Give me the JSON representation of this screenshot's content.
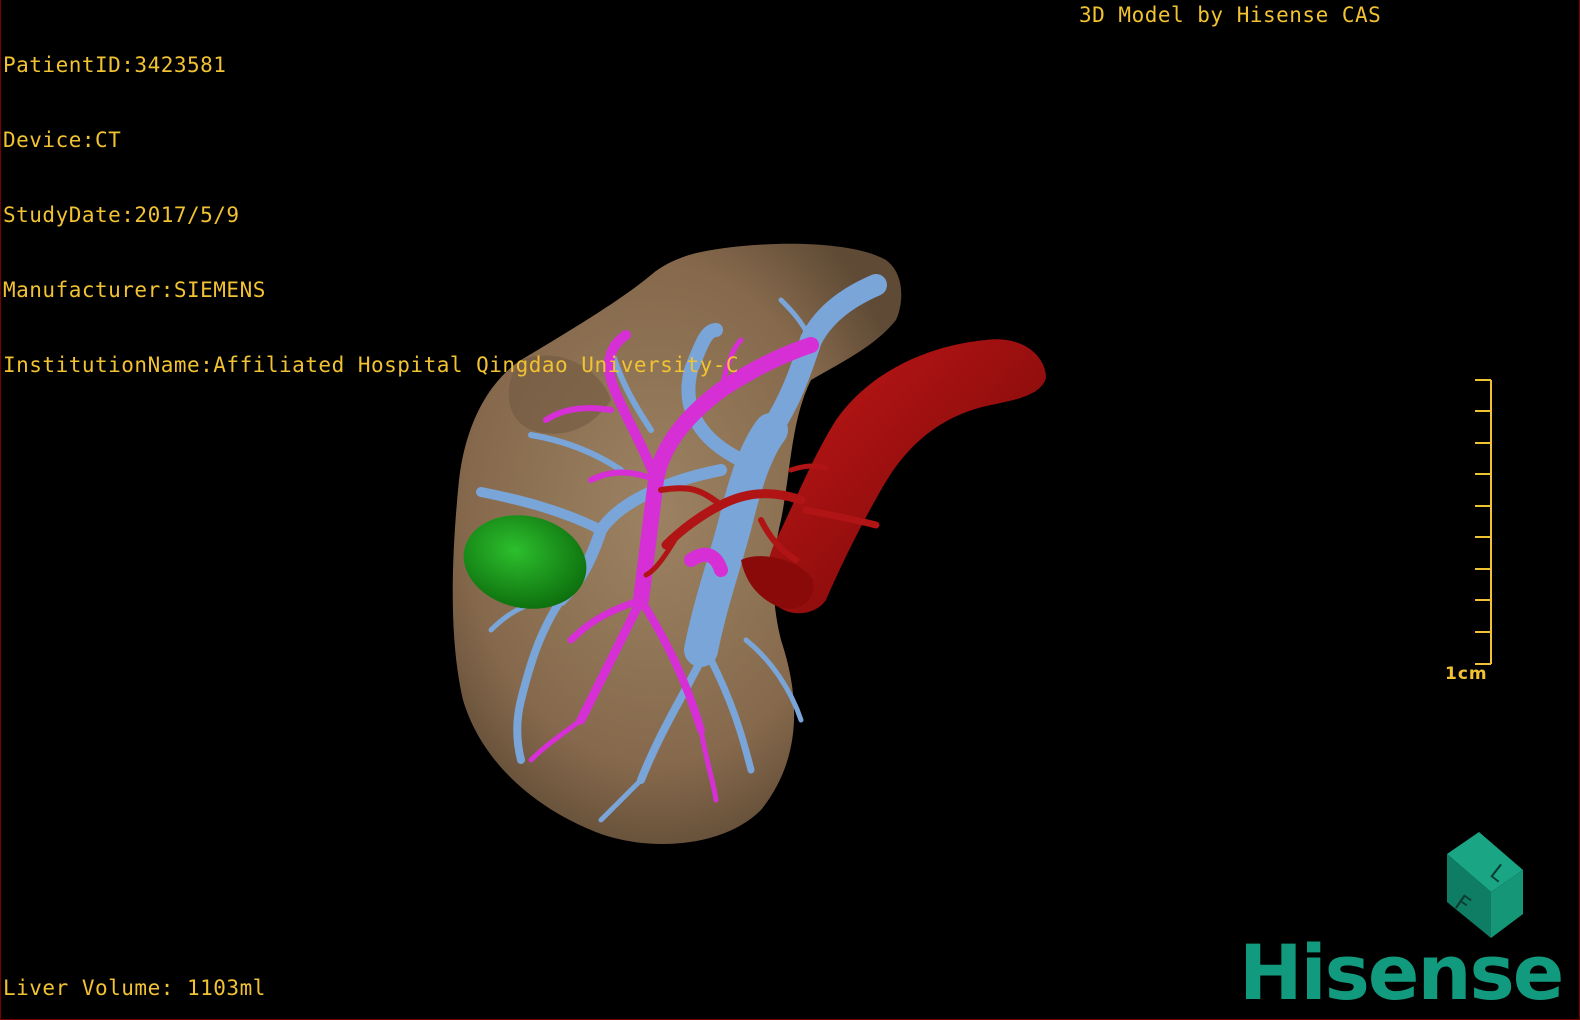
{
  "dicom_info": {
    "patient_id": "PatientID:3423581",
    "device": "Device:CT",
    "study_date": "StudyDate:2017/5/9",
    "manufacturer": "Manufacturer:SIEMENS",
    "institution": "InstitutionName:Affiliated Hospital Qingdao University-C"
  },
  "brand_text": "3D Model by Hisense CAS",
  "liver_volume": "Liver Volume: 1103ml",
  "scale_bar": {
    "label": "1cm"
  },
  "logo": {
    "text": "Hisense"
  },
  "orientation_cube": {
    "face_letters": [
      "F",
      "L"
    ]
  },
  "colors": {
    "text": "#f1c232",
    "liver": "#8a7256",
    "portal_vein": "#7aa5d8",
    "hepatic_vein": "#d62fd6",
    "artery": "#a50f0f",
    "tumor": "#1c9a1c",
    "logo": "#129a7e"
  }
}
